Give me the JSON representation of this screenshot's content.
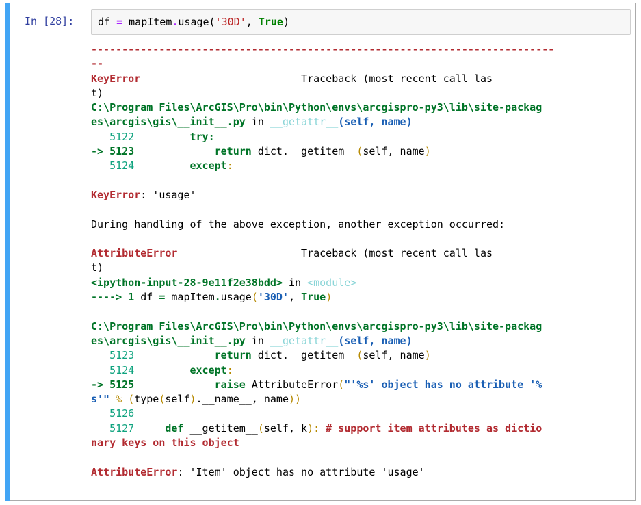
{
  "cell": {
    "prompt": "In [28]:",
    "input": {
      "t1": "df ",
      "t2": "=",
      "t3": " mapItem",
      "t4": ".",
      "t5": "usage(",
      "t6": "'30D'",
      "t7": ", ",
      "t8": "True",
      "t9": ")"
    }
  },
  "traceback": {
    "l1": "---------------------------------------------------------------------------",
    "l2": "--",
    "l3a": "KeyError",
    "l3b": "                          Traceback (most recent call las",
    "l4": "t)",
    "l5": "C:\\Program Files\\ArcGIS\\Pro\\bin\\Python\\envs\\arcgispro-py3\\lib\\site-packag",
    "l6a": "es\\arcgis\\gis\\__init__.py",
    "l6b": " in ",
    "l6c": "__getattr__",
    "l6d": "(self, name)",
    "l7a": "   5122 ",
    "l7b": "        try:",
    "l8a": "-> 5123 ",
    "l8b": "            return",
    "l8c": " dict.__getitem__",
    "l8d": "(",
    "l8e": "self, name",
    "l8f": ")",
    "l9a": "   5124 ",
    "l9b": "        except",
    "l9c": ":",
    "l10": "",
    "l11a": "KeyError",
    "l11b": ": 'usage'",
    "l12": "",
    "l13": "During handling of the above exception, another exception occurred:",
    "l14": "",
    "l15a": "AttributeError",
    "l15b": "                    Traceback (most recent call las",
    "l16": "t)",
    "l17a": "<ipython-input-28-9e11f2e38bdd>",
    "l17b": " in ",
    "l17c": "<module>",
    "l18a": "----> 1",
    "l18b": " df ",
    "l18c": "=",
    "l18d": " mapItem",
    "l18e": ".",
    "l18f": "usage",
    "l18g": "(",
    "l18h": "'30D'",
    "l18i": ", ",
    "l18j": "True",
    "l18k": ")",
    "l19": "",
    "l20": "C:\\Program Files\\ArcGIS\\Pro\\bin\\Python\\envs\\arcgispro-py3\\lib\\site-packag",
    "l21a": "es\\arcgis\\gis\\__init__.py",
    "l21b": " in ",
    "l21c": "__getattr__",
    "l21d": "(self, name)",
    "l22a": "   5123 ",
    "l22b": "            return",
    "l22c": " dict.__getitem__",
    "l22d": "(",
    "l22e": "self, name",
    "l22f": ")",
    "l23a": "   5124 ",
    "l23b": "        except",
    "l23c": ":",
    "l24a": "-> 5125 ",
    "l24b": "            raise",
    "l24c": " AttributeError",
    "l24d": "(",
    "l24e": "\"'%s' object has no attribute '%",
    "l25a": "s'\"",
    "l25b": " % ",
    "l25c": "(",
    "l25d": "type",
    "l25e": "(",
    "l25f": "self",
    "l25g": ")",
    "l25h": ".__name__, name",
    "l25i": "))",
    "l26a": "   5126 ",
    "l27a": "   5127 ",
    "l27b": "    def",
    "l27c": " __getitem__",
    "l27d": "(",
    "l27e": "self, k",
    "l27f": "):",
    "l27g": " # support item attributes as dictio",
    "l28": "nary keys on this object",
    "l29": "",
    "l30a": "AttributeError",
    "l30b": ": 'Item' object has no attribute 'usage'"
  },
  "colors": {
    "cell_bar": "#42a5f5",
    "prompt": "#303f9f",
    "error_name": "#b22b31",
    "path": "#007427"
  }
}
